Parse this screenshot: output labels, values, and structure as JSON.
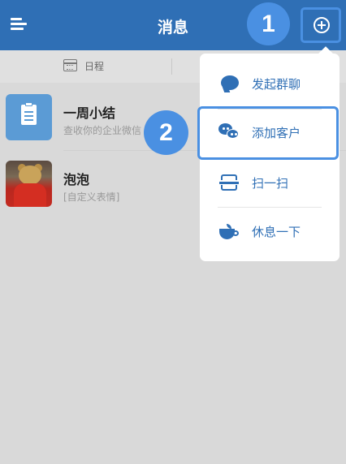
{
  "header": {
    "title": "消息"
  },
  "annotations": {
    "step1": "1",
    "step2": "2"
  },
  "tabs": {
    "schedule_label": "日程"
  },
  "messages": [
    {
      "name": "一周小结",
      "preview": "查收你的企业微信",
      "avatar_icon": "clipboard-icon"
    },
    {
      "name": "泡泡",
      "preview": "[自定义表情]",
      "avatar_icon": "photo-avatar"
    }
  ],
  "popup_menu": {
    "items": [
      {
        "label": "发起群聊",
        "icon": "chat-bubble-icon"
      },
      {
        "label": "添加客户",
        "icon": "wechat-icon"
      },
      {
        "label": "扫一扫",
        "icon": "scan-icon"
      },
      {
        "label": "休息一下",
        "icon": "coffee-cup-icon"
      }
    ]
  },
  "colors": {
    "header_bg": "#2f6fb5",
    "accent": "#4a90e2",
    "menu_text": "#2f6fb5",
    "overlay_bg": "#d9d9d9"
  }
}
